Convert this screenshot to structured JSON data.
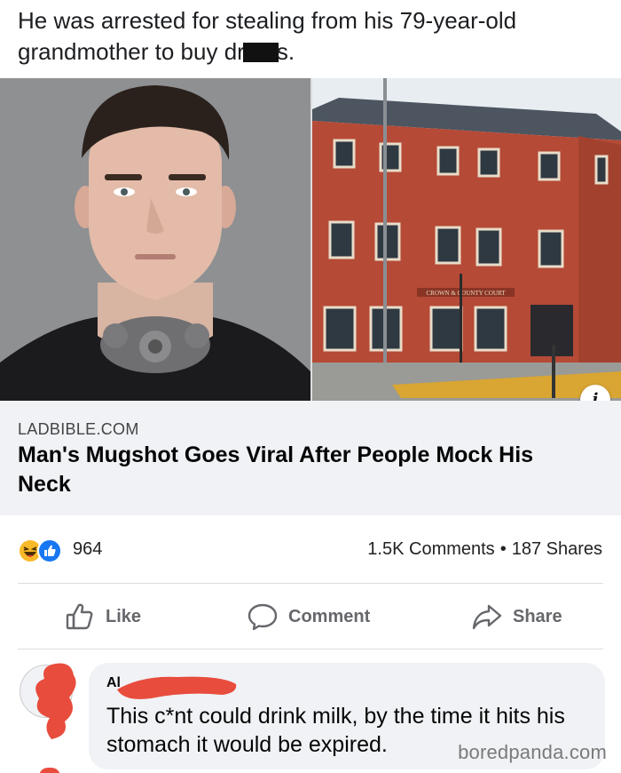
{
  "post": {
    "text_before": "He was arrested for stealing from his 79-year-old grandmother to buy dr",
    "text_after": "s."
  },
  "link_card": {
    "domain": "LADBIBLE.COM",
    "headline": "Man's Mugshot Goes Viral After People Mock His Neck",
    "info_icon": "i",
    "images": [
      "mugshot-photo",
      "court-building-photo"
    ],
    "court_sign": "CROWN & COUNTY COURT"
  },
  "reactions": {
    "icons": [
      "haha-icon",
      "like-icon"
    ],
    "count": "964",
    "comments": "1.5K Comments",
    "separator": "•",
    "shares": "187 Shares"
  },
  "actions": {
    "like": "Like",
    "comment": "Comment",
    "share": "Share"
  },
  "comment": {
    "author": "Al",
    "text": "This c*nt could drink milk, by the time it hits his stomach it would be expired."
  },
  "watermark": "boredpanda.com",
  "colors": {
    "brand_blue": "#1877f2",
    "haha_yellow": "#f7b928",
    "redaction_red": "#e84c3d",
    "action_gray": "#65676b",
    "card_bg": "#f0f2f5"
  }
}
